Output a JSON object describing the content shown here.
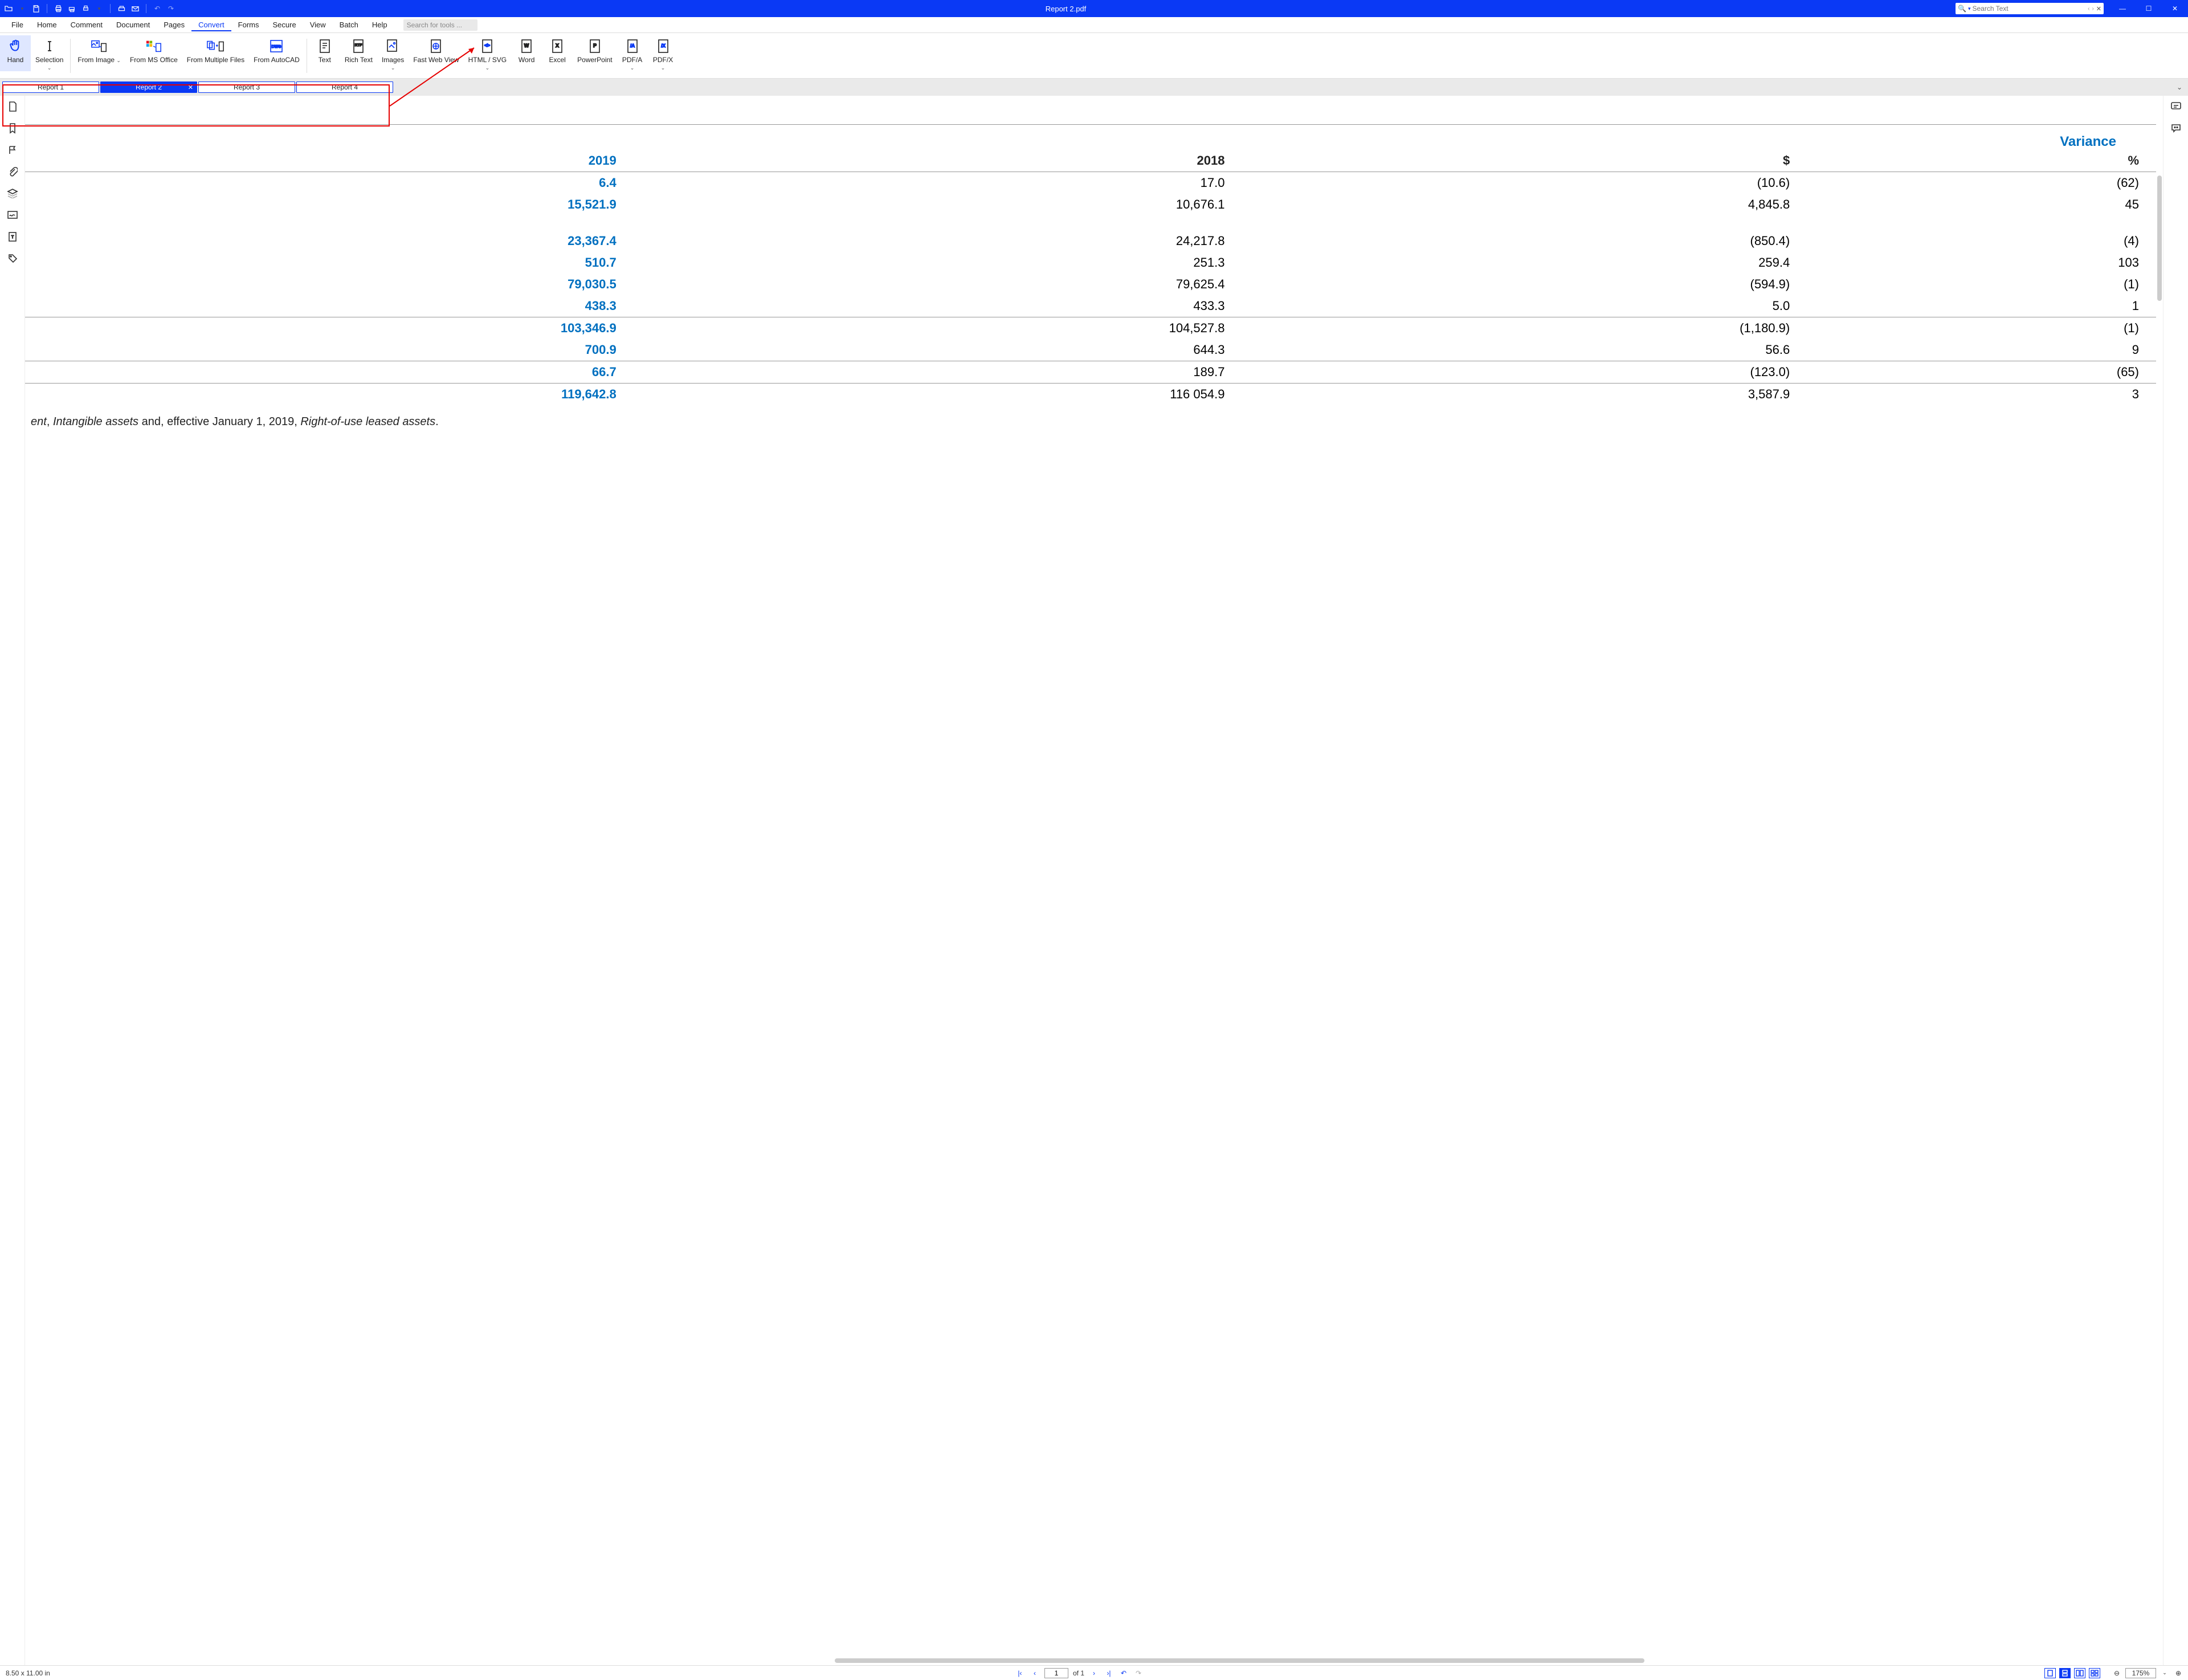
{
  "window": {
    "title": "Report 2.pdf"
  },
  "search": {
    "placeholder": "Search Text"
  },
  "menu": [
    "File",
    "Home",
    "Comment",
    "Document",
    "Pages",
    "Convert",
    "Forms",
    "Secure",
    "View",
    "Batch",
    "Help"
  ],
  "active_menu": "Convert",
  "tool_search_placeholder": "Search for tools ...",
  "ribbon": {
    "hand": "Hand",
    "selection": "Selection",
    "from_image": "From Image",
    "from_ms_office": "From MS Office",
    "from_multiple": "From Multiple Files",
    "from_autocad": "From AutoCAD",
    "text": "Text",
    "rich_text": "Rich Text",
    "images": "Images",
    "fast_web": "Fast Web View",
    "html_svg": "HTML / SVG",
    "word": "Word",
    "excel": "Excel",
    "powerpoint": "PowerPoint",
    "pdfa": "PDF/A",
    "pdfx": "PDF/X"
  },
  "tabs": [
    "Report 1",
    "Report 2",
    "Report 3",
    "Report 4"
  ],
  "active_tab": 1,
  "report": {
    "variance_label": "Variance",
    "headers": {
      "y2019": "2019",
      "y2018": "2018",
      "dollar": "$",
      "pct": "%"
    },
    "rows": [
      {
        "a": "6.4",
        "b": "17.0",
        "c": "(10.6)",
        "d": "(62)"
      },
      {
        "a": "15,521.9",
        "b": "10,676.1",
        "c": "4,845.8",
        "d": "45"
      },
      {
        "spacer": true
      },
      {
        "a": "23,367.4",
        "b": "24,217.8",
        "c": "(850.4)",
        "d": "(4)"
      },
      {
        "a": "510.7",
        "b": "251.3",
        "c": "259.4",
        "d": "103"
      },
      {
        "a": "79,030.5",
        "b": "79,625.4",
        "c": "(594.9)",
        "d": "(1)"
      },
      {
        "a": "438.3",
        "b": "433.3",
        "c": "5.0",
        "d": "1"
      },
      {
        "subtotal": true,
        "a": "103,346.9",
        "b": "104,527.8",
        "c": "(1,180.9)",
        "d": "(1)"
      },
      {
        "a": "700.9",
        "b": "644.3",
        "c": "56.6",
        "d": "9"
      },
      {
        "a": "66.7",
        "b": "189.7",
        "c": "(123.0)",
        "d": "(65)"
      },
      {
        "total": true,
        "a": "119,642.8",
        "b": "116 054.9",
        "c": "3,587.9",
        "d": "3"
      }
    ],
    "footnote_lead": "ent",
    "footnote_sep1": ", ",
    "footnote_i1": "Intangible assets",
    "footnote_mid": " and, effective January 1, 2019, ",
    "footnote_i2": "Right-of-use leased assets",
    "footnote_end": "."
  },
  "status": {
    "page_size": "8.50 x 11.00 in",
    "page_current": "1",
    "page_of": "of 1",
    "zoom": "175%"
  },
  "chart_data": {
    "type": "table",
    "title": "Variance",
    "columns": [
      "2019",
      "2018",
      "$",
      "%"
    ],
    "rows": [
      [
        "6.4",
        "17.0",
        "(10.6)",
        "(62)"
      ],
      [
        "15,521.9",
        "10,676.1",
        "4,845.8",
        "45"
      ],
      [
        "23,367.4",
        "24,217.8",
        "(850.4)",
        "(4)"
      ],
      [
        "510.7",
        "251.3",
        "259.4",
        "103"
      ],
      [
        "79,030.5",
        "79,625.4",
        "(594.9)",
        "(1)"
      ],
      [
        "438.3",
        "433.3",
        "5.0",
        "1"
      ],
      [
        "103,346.9",
        "104,527.8",
        "(1,180.9)",
        "(1)"
      ],
      [
        "700.9",
        "644.3",
        "56.6",
        "9"
      ],
      [
        "66.7",
        "189.7",
        "(123.0)",
        "(65)"
      ],
      [
        "119,642.8",
        "116 054.9",
        "3,587.9",
        "3"
      ]
    ]
  }
}
